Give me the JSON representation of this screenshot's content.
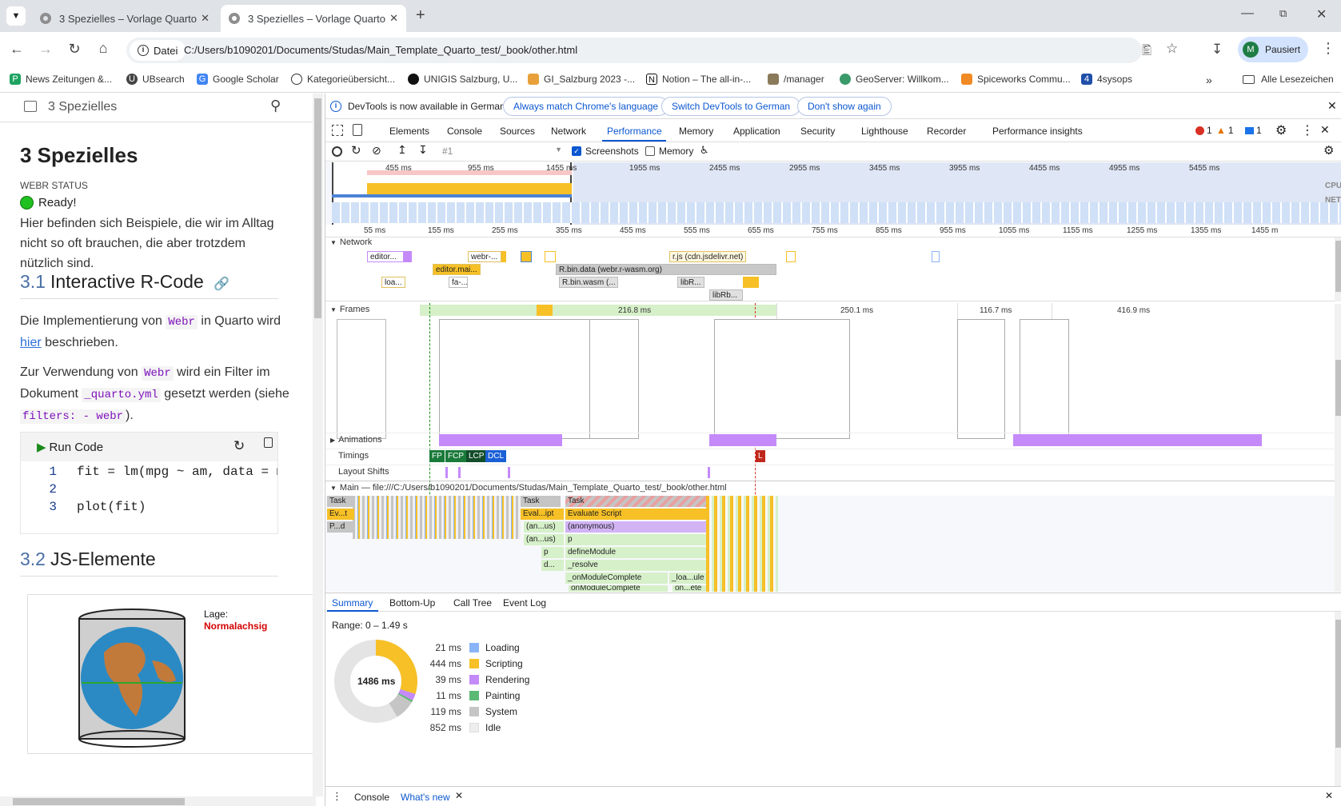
{
  "browser": {
    "tabs": [
      {
        "title": "3  Spezielles – Vorlage Quarto",
        "active": false
      },
      {
        "title": "3  Spezielles – Vorlage Quarto",
        "active": true
      }
    ],
    "address_scheme": "Datei",
    "address_url": "C:/Users/b1090201/Documents/Studas/Main_Template_Quarto_test/_book/other.html",
    "profile_initial": "M",
    "profile_label": "Pausiert",
    "bookmarks": [
      "News Zeitungen &...",
      "UBsearch",
      "Google Scholar",
      "Kategorieübersicht...",
      "UNIGIS Salzburg, U...",
      "GI_Salzburg 2023 -...",
      "Notion – The all-in-...",
      "/manager",
      "GeoServer: Willkom...",
      "Spiceworks Commu...",
      "4sysops"
    ],
    "all_bookmarks": "Alle Lesezeichen"
  },
  "page": {
    "sidebar_title": "3  Spezielles",
    "heading": "3  Spezielles",
    "webr_status_label": "WEBR STATUS",
    "webr_status_value": "Ready!",
    "intro": "Hier befinden sich Beispiele, die wir im Alltag nicht so oft brauchen, die aber trotzdem nützlich sind.",
    "section1_num": "3.1",
    "section1_title": "Interactive R-Code",
    "p1_a": "Die Implementierung von",
    "p1_code": "Webr",
    "p1_b": "in Quarto wird",
    "p1_link": "hier",
    "p1_c": "beschrieben.",
    "p2_a": "Zur Verwendung von",
    "p2_code": "Webr",
    "p2_b": "wird ein Filter im Dokument",
    "p2_code2": "_quarto.yml",
    "p2_c": "gesetzt werden (siehe",
    "p2_code3": "filters: - webr",
    "p2_d": ").",
    "run_code": "Run Code",
    "code_lines": [
      {
        "n": "1",
        "code": "fit = lm(mpg ~ am, data = mt"
      },
      {
        "n": "2",
        "code": ""
      },
      {
        "n": "3",
        "code": "plot(fit)"
      }
    ],
    "section2_num": "3.2",
    "section2_title": "JS-Elemente",
    "figure_label": "Lage:",
    "figure_value": "Normalachsig"
  },
  "devtools": {
    "infobar_text": "DevTools is now available in German!",
    "infobar_btn1": "Always match Chrome's language",
    "infobar_btn2": "Switch DevTools to German",
    "infobar_btn3": "Don't show again",
    "panels": [
      "Elements",
      "Console",
      "Sources",
      "Network",
      "Performance",
      "Memory",
      "Application",
      "Security",
      "Lighthouse",
      "Recorder",
      "Performance insights"
    ],
    "active_panel": "Performance",
    "errors": "1",
    "warnings": "1",
    "messages": "1",
    "recording_select": "#1",
    "screenshots_label": "Screenshots",
    "memory_label": "Memory",
    "overview_ticks": [
      "455 ms",
      "955 ms",
      "1455 ms",
      "1955 ms",
      "2455 ms",
      "2955 ms",
      "3455 ms",
      "3955 ms",
      "4455 ms",
      "4955 ms",
      "5455 ms"
    ],
    "cpu_label": "CPU",
    "net_label": "NET",
    "ruler_ticks": [
      "55 ms",
      "155 ms",
      "255 ms",
      "355 ms",
      "455 ms",
      "555 ms",
      "655 ms",
      "755 ms",
      "855 ms",
      "955 ms",
      "1055 ms",
      "1155 ms",
      "1255 ms",
      "1355 ms",
      "1455 m"
    ],
    "network_label": "Network",
    "network_items": [
      "editor...",
      "webr-...",
      "r.js (cdn.jsdelivr.net)",
      "editor.mai...",
      "R.bin.data (webr.r-wasm.org)",
      "loa...",
      "fa-...",
      "R.bin.wasm (...",
      "libR...",
      "libRb..."
    ],
    "frames_label": "Frames",
    "frame_durations": [
      "216.8 ms",
      "250.1 ms",
      "116.7 ms",
      "416.9 ms"
    ],
    "animations_label": "Animations",
    "timings_label": "Timings",
    "timing_markers": [
      "FP",
      "FCP",
      "LCP",
      "DCL",
      "L"
    ],
    "layout_shifts_label": "Layout Shifts",
    "main_label": "Main — file:///C:/Users/b1090201/Documents/Studas/Main_Template_Quarto_test/_book/other.html",
    "flame": {
      "row0": [
        "Task",
        "Task",
        "Task"
      ],
      "row1": [
        "Ev...t",
        "Eval...ipt",
        "Evaluate Script"
      ],
      "row2": [
        "P...d",
        "(an...us)",
        "(anonymous)"
      ],
      "row3": [
        "(an...us)",
        "p"
      ],
      "row4": [
        "p",
        "defineModule"
      ],
      "row5": [
        "d...",
        "_resolve"
      ],
      "row6": [
        "_onModuleComplete",
        "_loa...ule"
      ],
      "row7": [
        "onModuleComplete",
        "on...ete"
      ]
    },
    "bottom_tabs": [
      "Summary",
      "Bottom-Up",
      "Call Tree",
      "Event Log"
    ],
    "range": "Range: 0 – 1.49 s",
    "total": "1486 ms",
    "summary": [
      {
        "value": "21 ms",
        "label": "Loading",
        "color": "#8ab4f8"
      },
      {
        "value": "444 ms",
        "label": "Scripting",
        "color": "#f6c026"
      },
      {
        "value": "39 ms",
        "label": "Rendering",
        "color": "#c58af9"
      },
      {
        "value": "11 ms",
        "label": "Painting",
        "color": "#5bb974"
      },
      {
        "value": "119 ms",
        "label": "System",
        "color": "#c5c5c5"
      },
      {
        "value": "852 ms",
        "label": "Idle",
        "color": "#eeeeee"
      }
    ],
    "drawer_tabs": [
      "Console",
      "What's new"
    ]
  }
}
